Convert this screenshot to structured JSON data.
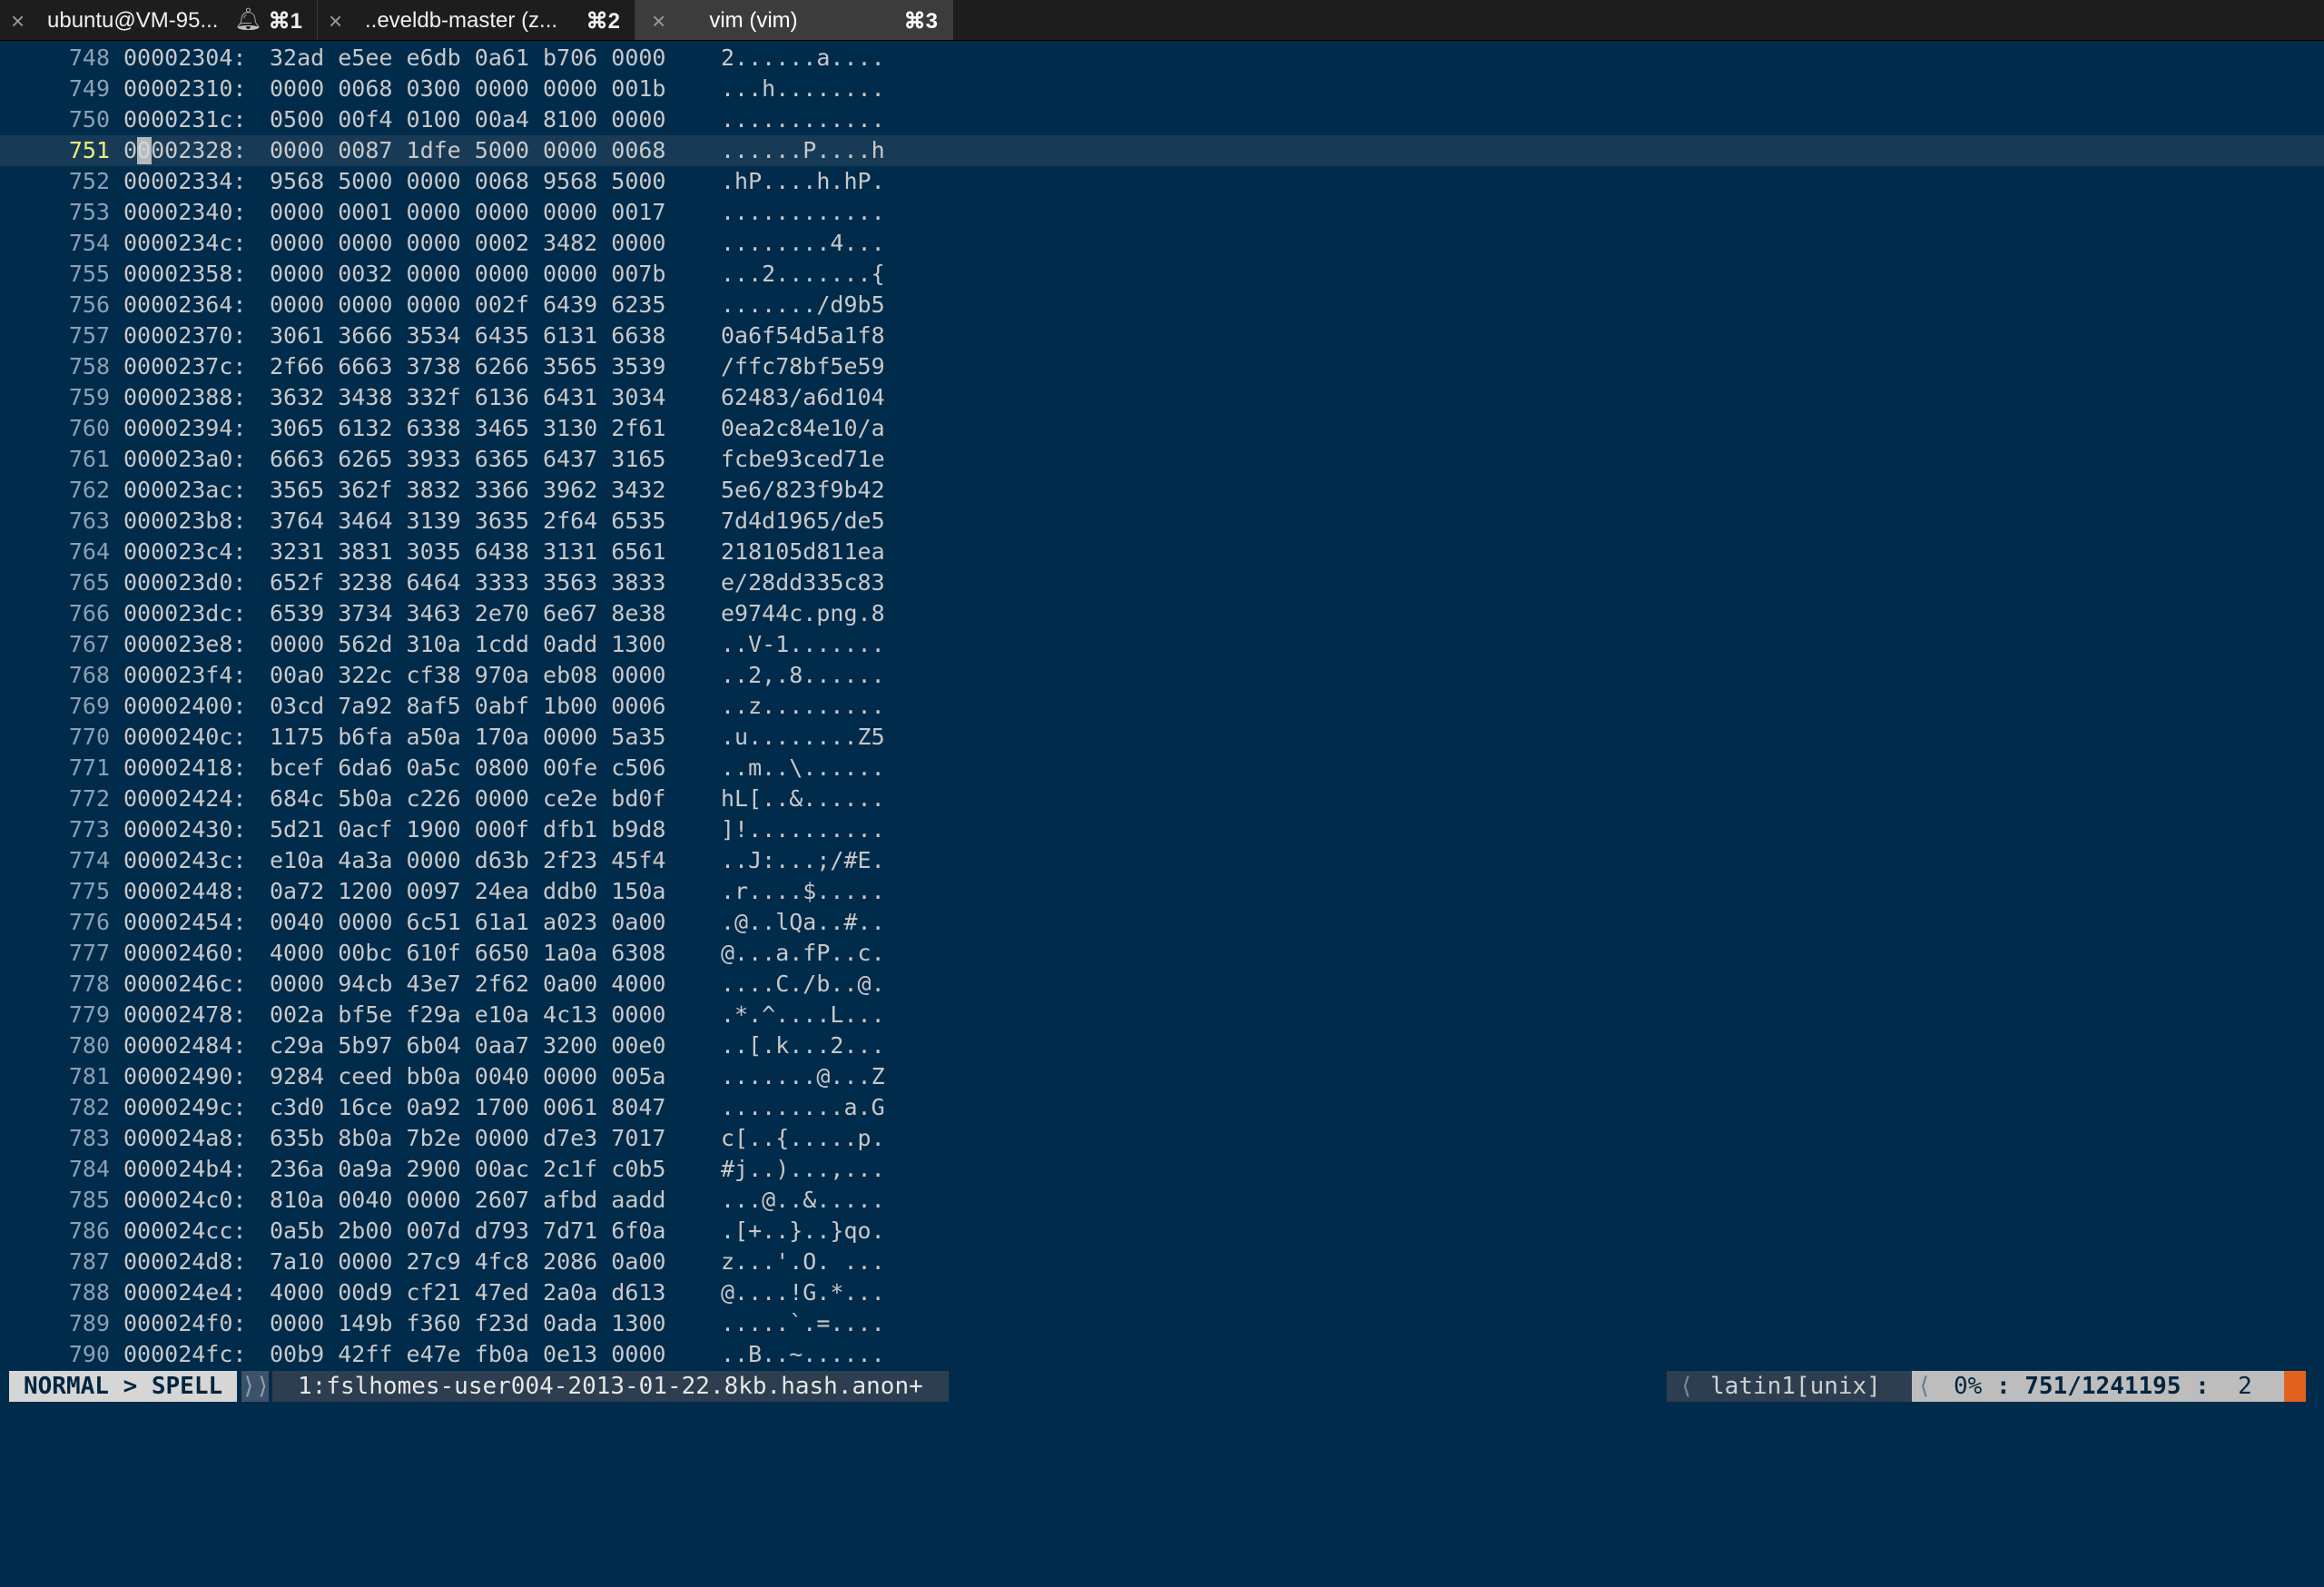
{
  "tabs": [
    {
      "title": "ubuntu@VM-95...",
      "shortcut": "⌘1",
      "has_bell": true,
      "active": false
    },
    {
      "title": "..eveldb-master (z...",
      "shortcut": "⌘2",
      "has_bell": false,
      "active": false
    },
    {
      "title": "vim (vim)",
      "shortcut": "⌘3",
      "has_bell": false,
      "active": true
    }
  ],
  "cursor_line": "751",
  "lines": [
    {
      "ln": "748",
      "addr": "00002304:",
      "hex": "32ad e5ee e6db 0a61 b706 0000",
      "ascii": "2......a...."
    },
    {
      "ln": "749",
      "addr": "00002310:",
      "hex": "0000 0068 0300 0000 0000 001b",
      "ascii": "...h........"
    },
    {
      "ln": "750",
      "addr": "0000231c:",
      "hex": "0500 00f4 0100 00a4 8100 0000",
      "ascii": "............"
    },
    {
      "ln": "751",
      "addr": "00002328:",
      "hex": "0000 0087 1dfe 5000 0000 0068",
      "ascii": "......P....h"
    },
    {
      "ln": "752",
      "addr": "00002334:",
      "hex": "9568 5000 0000 0068 9568 5000",
      "ascii": ".hP....h.hP."
    },
    {
      "ln": "753",
      "addr": "00002340:",
      "hex": "0000 0001 0000 0000 0000 0017",
      "ascii": "............"
    },
    {
      "ln": "754",
      "addr": "0000234c:",
      "hex": "0000 0000 0000 0002 3482 0000",
      "ascii": "........4..."
    },
    {
      "ln": "755",
      "addr": "00002358:",
      "hex": "0000 0032 0000 0000 0000 007b",
      "ascii": "...2.......{"
    },
    {
      "ln": "756",
      "addr": "00002364:",
      "hex": "0000 0000 0000 002f 6439 6235",
      "ascii": "......./d9b5"
    },
    {
      "ln": "757",
      "addr": "00002370:",
      "hex": "3061 3666 3534 6435 6131 6638",
      "ascii": "0a6f54d5a1f8"
    },
    {
      "ln": "758",
      "addr": "0000237c:",
      "hex": "2f66 6663 3738 6266 3565 3539",
      "ascii": "/ffc78bf5e59"
    },
    {
      "ln": "759",
      "addr": "00002388:",
      "hex": "3632 3438 332f 6136 6431 3034",
      "ascii": "62483/a6d104"
    },
    {
      "ln": "760",
      "addr": "00002394:",
      "hex": "3065 6132 6338 3465 3130 2f61",
      "ascii": "0ea2c84e10/a"
    },
    {
      "ln": "761",
      "addr": "000023a0:",
      "hex": "6663 6265 3933 6365 6437 3165",
      "ascii": "fcbe93ced71e"
    },
    {
      "ln": "762",
      "addr": "000023ac:",
      "hex": "3565 362f 3832 3366 3962 3432",
      "ascii": "5e6/823f9b42"
    },
    {
      "ln": "763",
      "addr": "000023b8:",
      "hex": "3764 3464 3139 3635 2f64 6535",
      "ascii": "7d4d1965/de5"
    },
    {
      "ln": "764",
      "addr": "000023c4:",
      "hex": "3231 3831 3035 6438 3131 6561",
      "ascii": "218105d811ea"
    },
    {
      "ln": "765",
      "addr": "000023d0:",
      "hex": "652f 3238 6464 3333 3563 3833",
      "ascii": "e/28dd335c83"
    },
    {
      "ln": "766",
      "addr": "000023dc:",
      "hex": "6539 3734 3463 2e70 6e67 8e38",
      "ascii": "e9744c.png.8"
    },
    {
      "ln": "767",
      "addr": "000023e8:",
      "hex": "0000 562d 310a 1cdd 0add 1300",
      "ascii": "..V-1......."
    },
    {
      "ln": "768",
      "addr": "000023f4:",
      "hex": "00a0 322c cf38 970a eb08 0000",
      "ascii": "..2,.8......"
    },
    {
      "ln": "769",
      "addr": "00002400:",
      "hex": "03cd 7a92 8af5 0abf 1b00 0006",
      "ascii": "..z........."
    },
    {
      "ln": "770",
      "addr": "0000240c:",
      "hex": "1175 b6fa a50a 170a 0000 5a35",
      "ascii": ".u........Z5"
    },
    {
      "ln": "771",
      "addr": "00002418:",
      "hex": "bcef 6da6 0a5c 0800 00fe c506",
      "ascii": "..m..\\......"
    },
    {
      "ln": "772",
      "addr": "00002424:",
      "hex": "684c 5b0a c226 0000 ce2e bd0f",
      "ascii": "hL[..&......"
    },
    {
      "ln": "773",
      "addr": "00002430:",
      "hex": "5d21 0acf 1900 000f dfb1 b9d8",
      "ascii": "]!.........."
    },
    {
      "ln": "774",
      "addr": "0000243c:",
      "hex": "e10a 4a3a 0000 d63b 2f23 45f4",
      "ascii": "..J:...;/#E."
    },
    {
      "ln": "775",
      "addr": "00002448:",
      "hex": "0a72 1200 0097 24ea ddb0 150a",
      "ascii": ".r....$....."
    },
    {
      "ln": "776",
      "addr": "00002454:",
      "hex": "0040 0000 6c51 61a1 a023 0a00",
      "ascii": ".@..lQa..#.."
    },
    {
      "ln": "777",
      "addr": "00002460:",
      "hex": "4000 00bc 610f 6650 1a0a 6308",
      "ascii": "@...a.fP..c."
    },
    {
      "ln": "778",
      "addr": "0000246c:",
      "hex": "0000 94cb 43e7 2f62 0a00 4000",
      "ascii": "....C./b..@."
    },
    {
      "ln": "779",
      "addr": "00002478:",
      "hex": "002a bf5e f29a e10a 4c13 0000",
      "ascii": ".*.^....L..."
    },
    {
      "ln": "780",
      "addr": "00002484:",
      "hex": "c29a 5b97 6b04 0aa7 3200 00e0",
      "ascii": "..[.k...2..."
    },
    {
      "ln": "781",
      "addr": "00002490:",
      "hex": "9284 ceed bb0a 0040 0000 005a",
      "ascii": ".......@...Z"
    },
    {
      "ln": "782",
      "addr": "0000249c:",
      "hex": "c3d0 16ce 0a92 1700 0061 8047",
      "ascii": ".........a.G"
    },
    {
      "ln": "783",
      "addr": "000024a8:",
      "hex": "635b 8b0a 7b2e 0000 d7e3 7017",
      "ascii": "c[..{.....p."
    },
    {
      "ln": "784",
      "addr": "000024b4:",
      "hex": "236a 0a9a 2900 00ac 2c1f c0b5",
      "ascii": "#j..)...,..."
    },
    {
      "ln": "785",
      "addr": "000024c0:",
      "hex": "810a 0040 0000 2607 afbd aadd",
      "ascii": "...@..&....."
    },
    {
      "ln": "786",
      "addr": "000024cc:",
      "hex": "0a5b 2b00 007d d793 7d71 6f0a",
      "ascii": ".[+..}..}qo."
    },
    {
      "ln": "787",
      "addr": "000024d8:",
      "hex": "7a10 0000 27c9 4fc8 2086 0a00",
      "ascii": "z...'.O. ..."
    },
    {
      "ln": "788",
      "addr": "000024e4:",
      "hex": "4000 00d9 cf21 47ed 2a0a d613",
      "ascii": "@....!G.*..."
    },
    {
      "ln": "789",
      "addr": "000024f0:",
      "hex": "0000 149b f360 f23d 0ada 1300",
      "ascii": ".....`.=...."
    },
    {
      "ln": "790",
      "addr": "000024fc:",
      "hex": "00b9 42ff e47e fb0a 0e13 0000",
      "ascii": "..B..~......"
    }
  ],
  "status": {
    "mode": "NORMAL > SPELL",
    "mode_sep": "⟩⟩",
    "file": "1:fslhomes-user004-2013-01-22.8kb.hash.anon+",
    "enc_sep": "⟨",
    "encoding": "latin1[unix]",
    "pos_sep": "⟨",
    "percent": "0%",
    "position": "751/1241195",
    "column": "2"
  },
  "colors": {
    "background": "#002b4b",
    "cursor_line_bg": "#173b56",
    "cursor_line_number": "#f1ec7a",
    "line_number": "#8ba1b3",
    "text": "#c8c8c8",
    "status_warn": "#e0621e"
  }
}
